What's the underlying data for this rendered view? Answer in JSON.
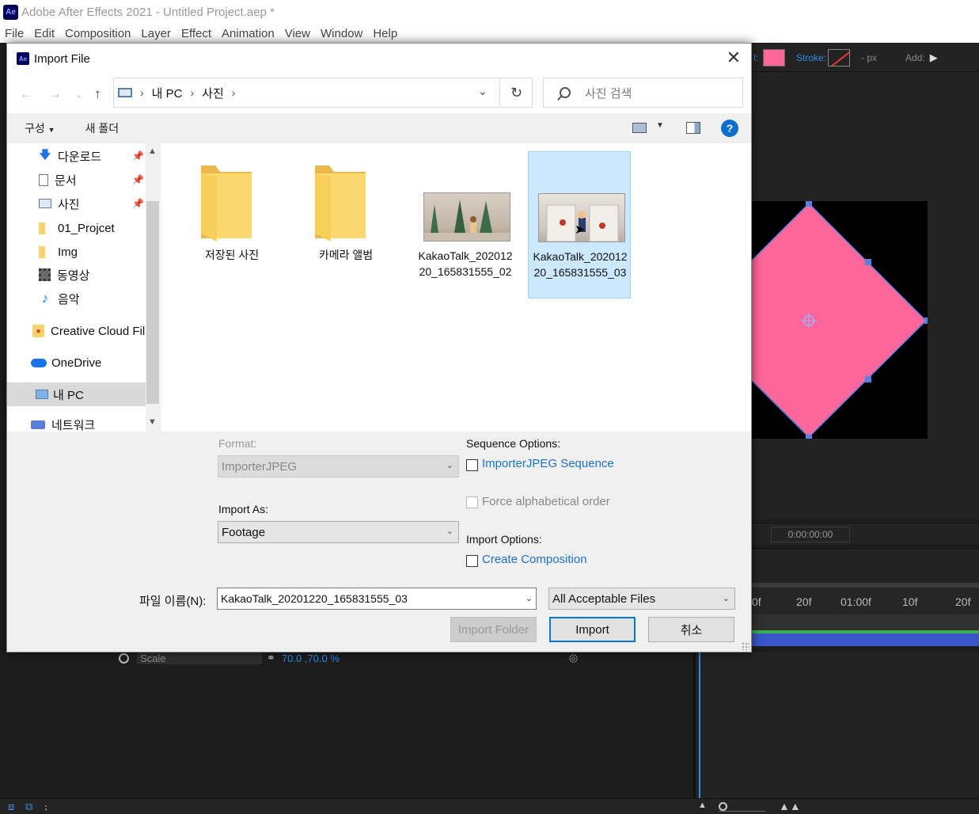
{
  "app": {
    "logo": "Ae",
    "title": "Adobe After Effects 2021 - Untitled Project.aep *",
    "menu": [
      "File",
      "Edit",
      "Composition",
      "Layer",
      "Effect",
      "Animation",
      "View",
      "Window",
      "Help"
    ],
    "toolbar": {
      "fill_label": "l:",
      "stroke_label": "Stroke:",
      "stroke_px": "- px",
      "add_label": "Add:"
    },
    "fill_color": "#ff6699",
    "viewer_timecode": "0:00:00:00",
    "ruler_ticks": [
      "0f",
      "20f",
      "01:00f",
      "10f",
      "20f"
    ],
    "scale_row": {
      "label": "Scale",
      "value": "70.0 ,70.0 %"
    }
  },
  "dialog": {
    "icon": "Ae",
    "title": "Import File",
    "nav": {
      "back_icon": "back-arrow-icon",
      "forward_icon": "forward-arrow-icon",
      "up_icon": "up-arrow-icon",
      "breadcrumb": [
        "내 PC",
        "사진"
      ],
      "search_placeholder": "사진 검색"
    },
    "commands": {
      "organize": "구성",
      "new_folder": "새 폴더",
      "help": "?"
    },
    "nav_pane": [
      {
        "label": "다운로드",
        "icon": "download-icon",
        "pinned": true
      },
      {
        "label": "문서",
        "icon": "document-icon",
        "pinned": true
      },
      {
        "label": "사진",
        "icon": "pictures-icon",
        "pinned": true
      },
      {
        "label": "01_Projcet",
        "icon": "folder-icon",
        "pinned": false
      },
      {
        "label": "Img",
        "icon": "folder-icon",
        "pinned": false
      },
      {
        "label": "동영상",
        "icon": "video-icon",
        "pinned": false
      },
      {
        "label": "음악",
        "icon": "music-icon",
        "pinned": false
      },
      {
        "label": "Creative Cloud Fil",
        "icon": "creative-cloud-icon",
        "pinned": false
      },
      {
        "label": "OneDrive",
        "icon": "onedrive-icon",
        "pinned": false
      },
      {
        "label": "내 PC",
        "icon": "pc-icon",
        "pinned": false,
        "selected": true
      },
      {
        "label": "네트워크",
        "icon": "network-icon",
        "pinned": false
      }
    ],
    "files": [
      {
        "name": "저장된 사진",
        "type": "folder"
      },
      {
        "name": "카메라 앨범",
        "type": "folder"
      },
      {
        "name": "KakaoTalk_20201220_165831555_02",
        "type": "image"
      },
      {
        "name": "KakaoTalk_20201220_165831555_03",
        "type": "image",
        "selected": true
      }
    ],
    "options": {
      "format_label": "Format:",
      "format_value": "ImporterJPEG",
      "import_as_label": "Import As:",
      "import_as_value": "Footage",
      "sequence_label": "Sequence Options:",
      "sequence_checkbox": "ImporterJPEG Sequence",
      "force_alpha": "Force alphabetical order",
      "import_options_label": "Import Options:",
      "create_comp": "Create Composition"
    },
    "filename_label": "파일 이름(N):",
    "filename_value": "KakaoTalk_20201220_165831555_03",
    "filetype_value": "All Acceptable Files",
    "buttons": {
      "import_folder": "Import Folder",
      "import": "Import",
      "cancel": "취소"
    }
  }
}
